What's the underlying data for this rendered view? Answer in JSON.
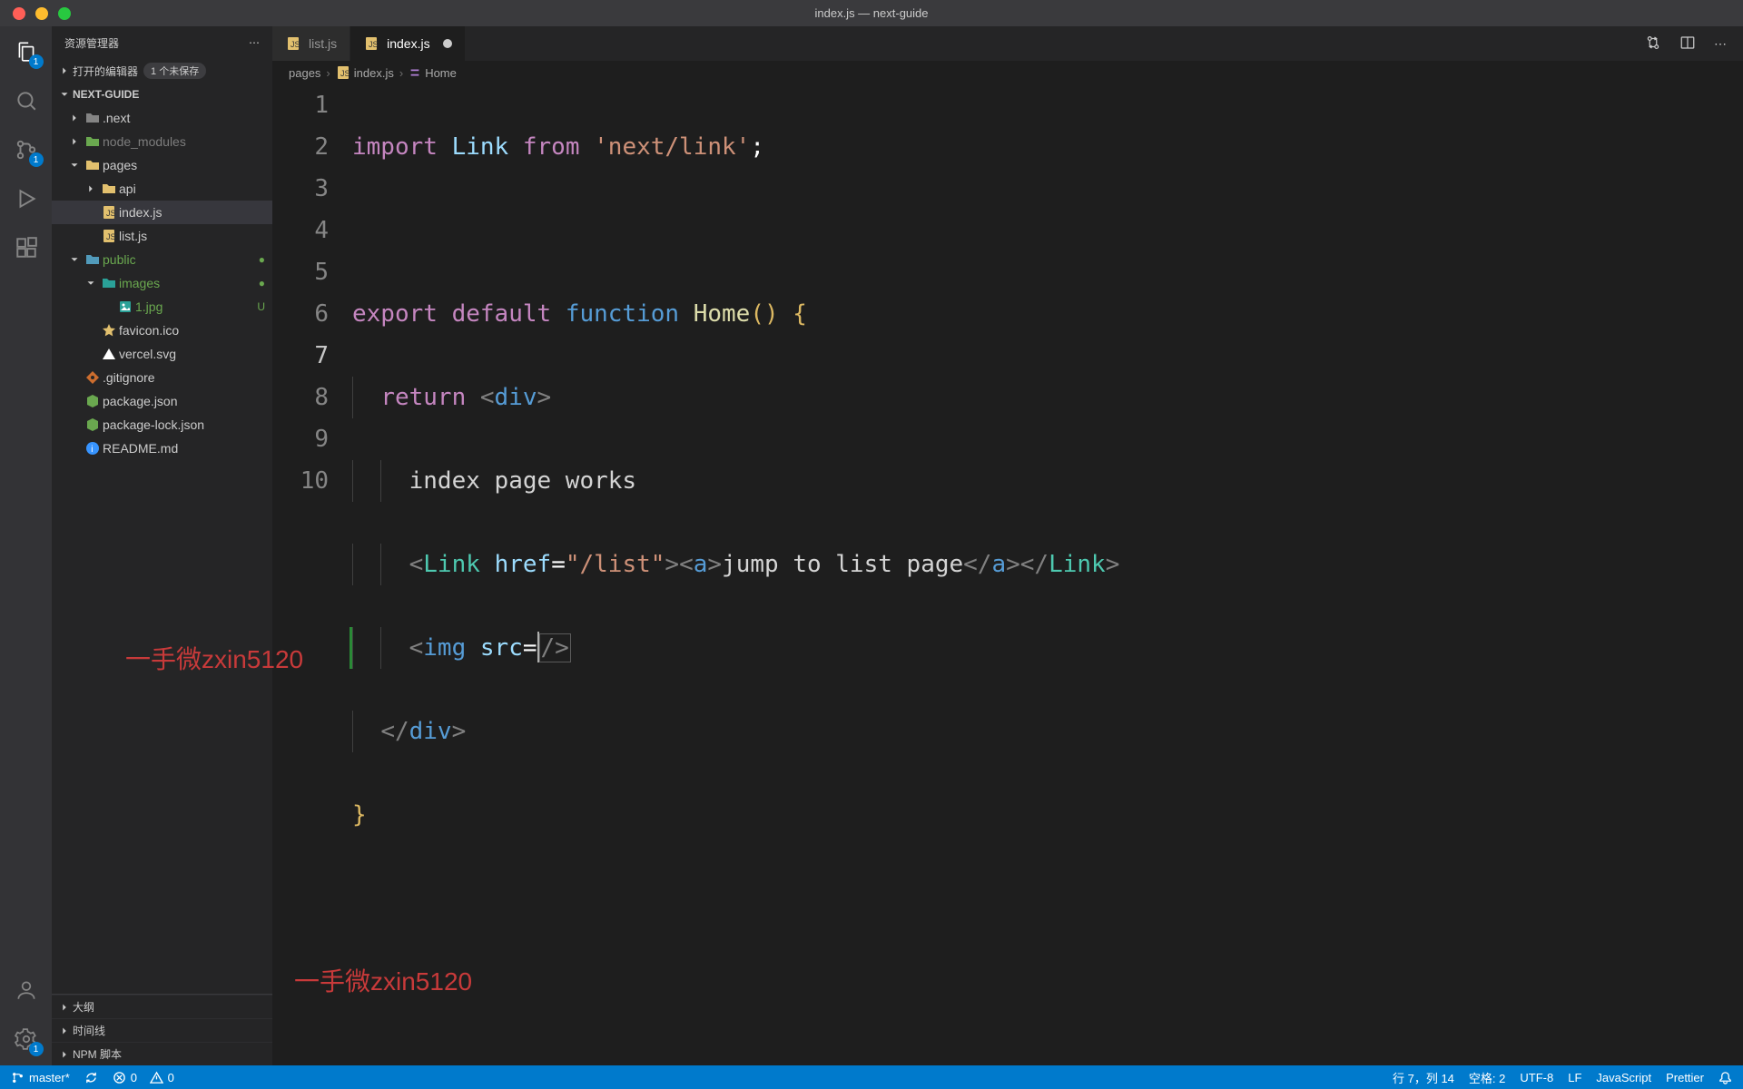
{
  "window": {
    "title": "index.js — next-guide"
  },
  "sidebar": {
    "header": "资源管理器",
    "open_editors_label": "打开的编辑器",
    "open_editors_badge": "1 个未保存",
    "project": "NEXT-GUIDE",
    "outline": "大纲",
    "timeline": "时间线",
    "npm": "NPM 脚本"
  },
  "tree": {
    "next": ".next",
    "node_modules": "node_modules",
    "pages": "pages",
    "api": "api",
    "index_js": "index.js",
    "list_js": "list.js",
    "public": "public",
    "images": "images",
    "img1": "1.jpg",
    "favicon": "favicon.ico",
    "vercel": "vercel.svg",
    "gitignore": ".gitignore",
    "pkg": "package.json",
    "pkglock": "package-lock.json",
    "readme": "README.md",
    "deco_u": "U"
  },
  "tabs": {
    "list": "list.js",
    "index": "index.js"
  },
  "breadcrumbs": {
    "a": "pages",
    "b": "index.js",
    "c": "Home"
  },
  "code": {
    "import": "import",
    "link": "Link",
    "from": "from",
    "nextlink": "'next/link'",
    "export": "export",
    "default": "default",
    "function": "function",
    "home": "Home",
    "return": "return",
    "div": "div",
    "text_index": "index page works",
    "href": "href",
    "list_str": "\"/list\"",
    "a": "a",
    "jump": "jump to list page",
    "img": "img",
    "src": "src"
  },
  "line_numbers": [
    "1",
    "2",
    "3",
    "4",
    "5",
    "6",
    "7",
    "8",
    "9",
    "10"
  ],
  "watermark": "一手微zxin5120",
  "status": {
    "branch": "master*",
    "errors": "0",
    "warnings": "0",
    "lncol": "行 7，列 14",
    "spaces": "空格: 2",
    "encoding": "UTF-8",
    "eol": "LF",
    "lang": "JavaScript",
    "prettier": "Prettier"
  },
  "activity_badges": {
    "explorer": "1",
    "scm": "1",
    "settings": "1"
  }
}
